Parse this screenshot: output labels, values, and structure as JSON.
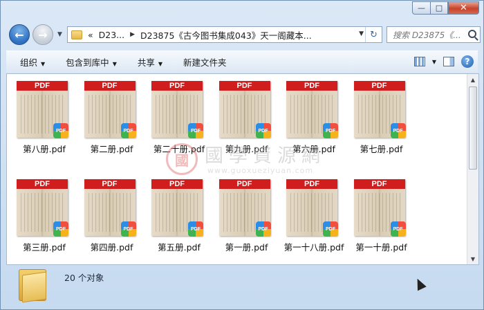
{
  "window": {
    "minimize_glyph": "—",
    "maximize_glyph": "□",
    "close_glyph": "✕"
  },
  "nav": {
    "back_glyph": "←",
    "forward_glyph": "→",
    "history_glyph": "▼",
    "breadcrumb_prefix": "«",
    "breadcrumb_root": "D23...",
    "breadcrumb_sep": "▶",
    "breadcrumb_current": "D23875《古今图书集成043》天一阁藏本...",
    "address_dropdown_glyph": "▼",
    "refresh_glyph": "↻",
    "search_placeholder": "搜索 D23875《..."
  },
  "toolbar": {
    "organize": "组织",
    "include_in_library": "包含到库中",
    "share": "共享",
    "new_folder": "新建文件夹",
    "dropdown_glyph": "▼",
    "help_glyph": "?"
  },
  "files": [
    {
      "name": "第八册.pdf"
    },
    {
      "name": "第二册.pdf"
    },
    {
      "name": "第二十册.pdf"
    },
    {
      "name": "第九册.pdf"
    },
    {
      "name": "第六册.pdf"
    },
    {
      "name": "第七册.pdf"
    },
    {
      "name": "第三册.pdf"
    },
    {
      "name": "第四册.pdf"
    },
    {
      "name": "第五册.pdf"
    },
    {
      "name": "第一册.pdf"
    },
    {
      "name": "第一十八册.pdf"
    },
    {
      "name": "第一十册.pdf"
    }
  ],
  "pdf_band_text": "PDF",
  "pdf_badge_text": "PDF",
  "watermark": {
    "seal": "國",
    "chinese": "國學資源網",
    "url": "www.guoxueziyuan.com"
  },
  "scrollbar": {
    "up_glyph": "▲",
    "down_glyph": "▼"
  },
  "status": {
    "count_text": "20 个对象"
  },
  "colors": {
    "pdf_band": "#d01e1e",
    "accent": "#2d6fc0"
  }
}
